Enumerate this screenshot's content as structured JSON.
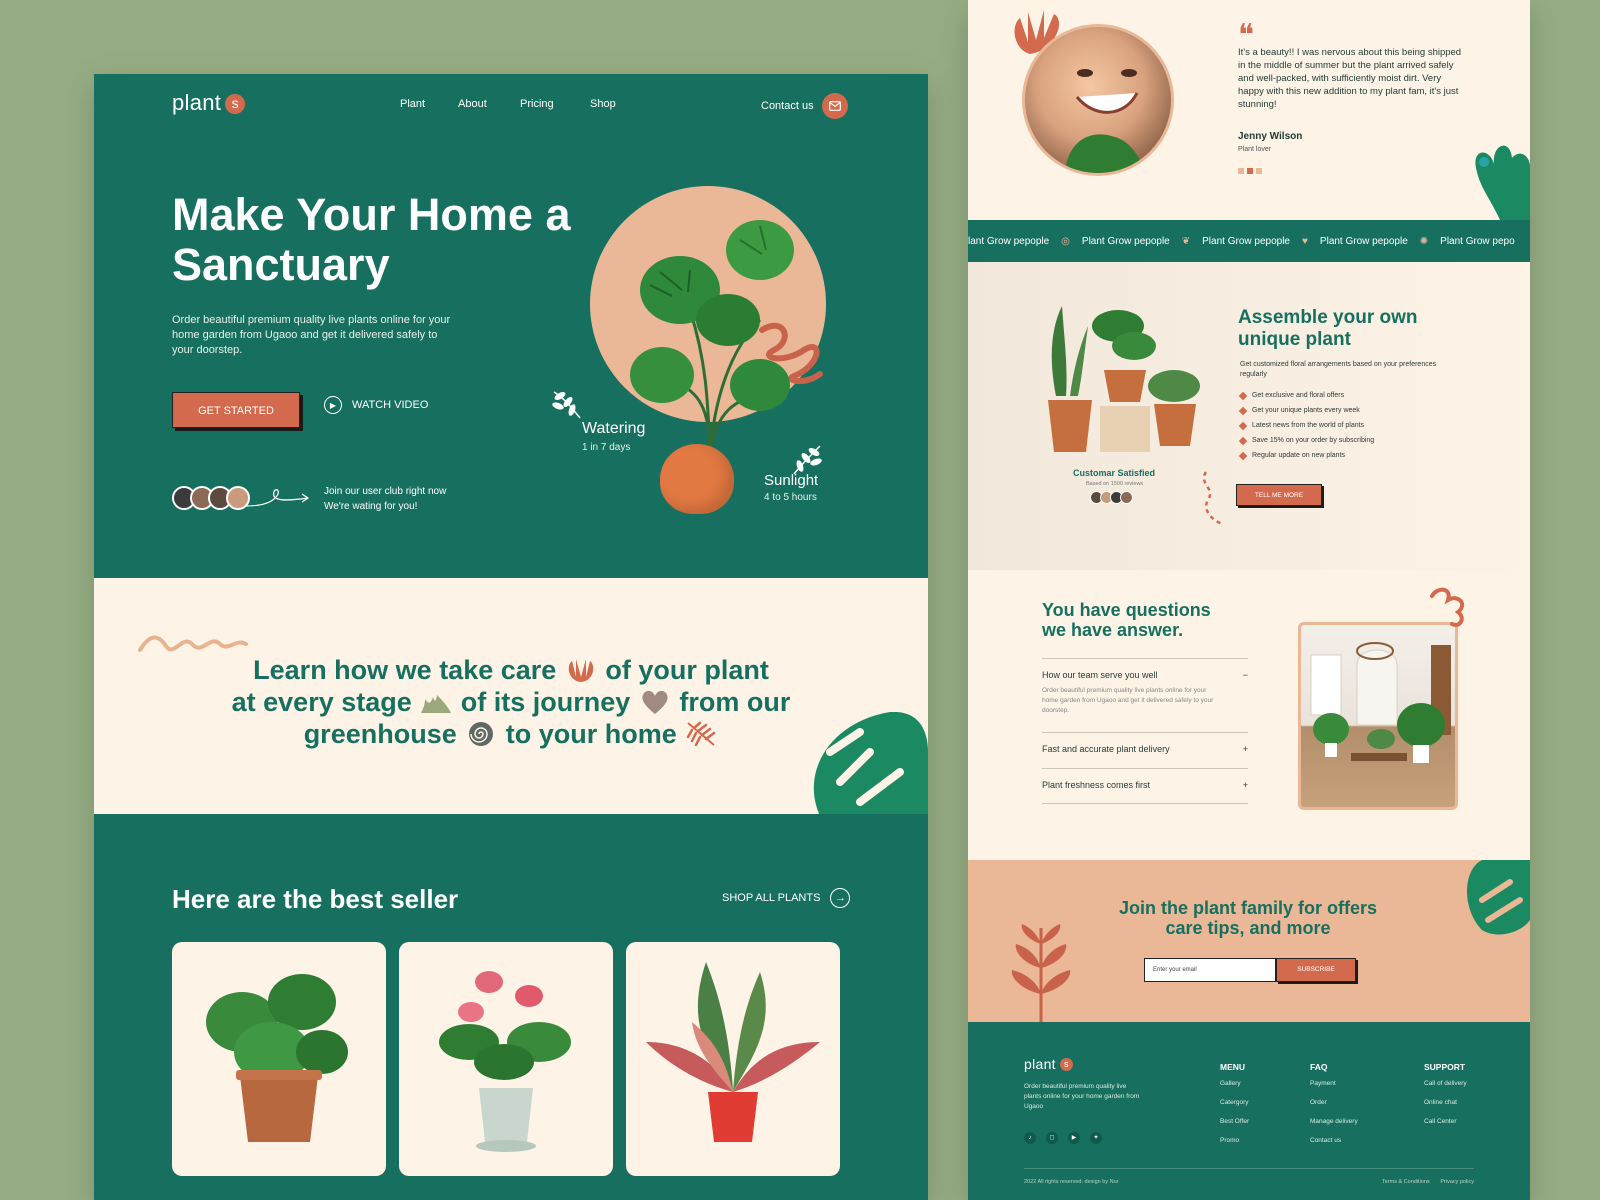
{
  "brand": {
    "name": "plant",
    "mark": "s"
  },
  "nav": [
    "Plant",
    "About",
    "Pricing",
    "Shop"
  ],
  "contact_label": "Contact us",
  "hero": {
    "title": "Make Your Home a Sanctuary",
    "description": "Order beautiful premium quality live plants online for your home garden from Ugaoo and get it delivered safely to your doorstep.",
    "cta_primary": "GET STARTED",
    "cta_secondary": "WATCH VIDEO",
    "club_line1": "Join our user club right now",
    "club_line2": "We're wating for you!",
    "watering_label": "Watering",
    "watering_value": "1 in 7 days",
    "sunlight_label": "Sunlight",
    "sunlight_value": "4 to 5 hours"
  },
  "learn": {
    "part1": "Learn  how we take care",
    "part2": "of your plant",
    "part3": "at every stage",
    "part4": "of its journey",
    "part5": "from our",
    "part6": "greenhouse",
    "part7": "to your home"
  },
  "best": {
    "title": "Here are the best seller",
    "shop_all": "SHOP ALL PLANTS"
  },
  "testimonial": {
    "quote": "It's a beauty!! I was nervous about this being shipped in the middle of summer but the plant arrived safely and well-packed, with sufficiently moist dirt. Very happy with this new addition to my plant fam, it's just stunning!",
    "name": "Jenny Wilson",
    "role": "Plant lover"
  },
  "marquee": [
    "lant Grow pepople",
    "Plant Grow pepople",
    "Plant Grow pepople",
    "Plant Grow pepople",
    "Plant Grow pepo"
  ],
  "assemble": {
    "title_line1": "Assemble your own",
    "title_line2": "unique plant",
    "description": "Get customized floral arrangements based on your preferences regularly",
    "bullets": [
      "Get exclusive and floral offers",
      "Get your unique plants every week",
      "Latest news from the world of plants",
      "Save 15% on your order by subscribing",
      "Regular update on new plants"
    ],
    "button": "TELL ME MORE",
    "satisfied_label": "Customar Satisfied",
    "satisfied_sub": "Based on 1500 reviews"
  },
  "faq": {
    "title_line1": "You have questions",
    "title_line2": "we have answer.",
    "items": [
      {
        "q": "How our team serve you well",
        "a": "Order beautiful premium quality live plants online for your home garden from Ugaoo and get it delivered safely to your doorstep.",
        "toggle": "−"
      },
      {
        "q": "Fast and accurate plant delivery",
        "toggle": "+"
      },
      {
        "q": "Plant freshness comes first",
        "toggle": "+"
      }
    ]
  },
  "join": {
    "title_line1": "Join the plant family for offers",
    "title_line2": "care tips, and more",
    "email_placeholder": "Enter your email",
    "subscribe": "SUBSCRIBE"
  },
  "footer": {
    "description": "Order beautiful premium quality live plants online for your home garden from Ugaoo",
    "menu_title": "MENU",
    "menu": [
      "Gallery",
      "Catergory",
      "Best Offer",
      "Promo"
    ],
    "faq_title": "FAQ",
    "faq": [
      "Payment",
      "Order",
      "Manage delivery",
      "Contact us"
    ],
    "support_title": "SUPPORT",
    "support": [
      "Call of delivery",
      "Online chat",
      "Call Center"
    ],
    "copyright": "2022 All rights reserved. design by Nur",
    "terms": "Terms & Conditions",
    "privacy": "Privacy policy"
  },
  "colors": {
    "green": "#17705f",
    "cream": "#fdf3e7",
    "peach": "#eab797",
    "terracotta": "#d46a4d",
    "background": "#96ad84"
  }
}
